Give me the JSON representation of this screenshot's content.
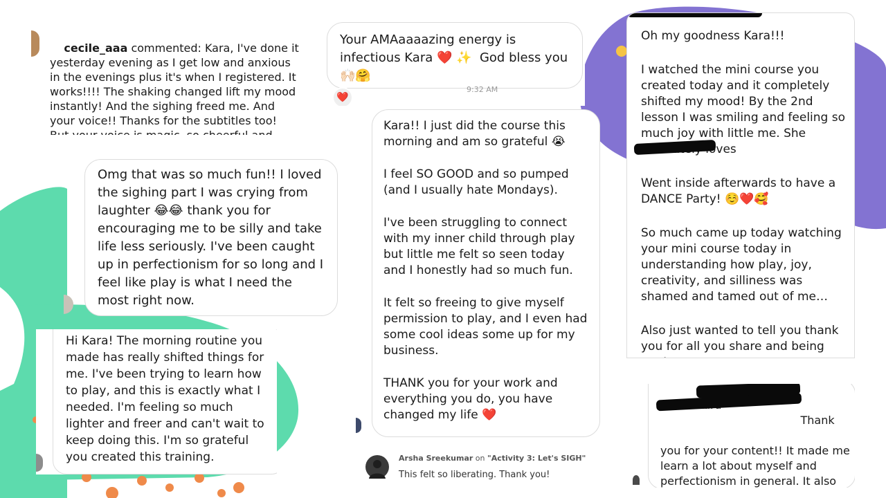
{
  "testimonial_1": {
    "username": "cecile_aaa",
    "text": "commented: Kara, I've done it yesterday evening as I get low and anxious in the evenings plus it's when I registered. It works!!!! The shaking changed lift my mood instantly! And the sighing freed me. And your voice!! Thanks for the subtitles too! But your voice is magic, so cheerful and kind! So"
  },
  "testimonial_2": {
    "text": "Your AMAaaaazing energy is infectious Kara ❤️ ✨  God bless you 🙌🏻🤗",
    "time": "9:32 AM",
    "reaction": "❤️"
  },
  "testimonial_3": {
    "paragraphs": [
      "Oh my goodness Kara!!!",
      "I watched the mini course you created today and it completely shifted my mood! By the 2nd lesson I was smiling and feeling so much joy with little me. She absolutely loves",
      "Went inside afterwards to have a DANCE Party! ☺️❤️🥰",
      "So much came up today watching your mini course today in understanding how play, joy, creativity, and silliness was shamed and tamed out of me…",
      "Also just wanted to tell you thank you for all you share and being you!"
    ]
  },
  "testimonial_4": {
    "text": "Omg that was so much fun!! I loved the sighing part I was crying from laughter 😂😂 thank you for encouraging me to be silly and take life less seriously. I've been caught up in perfectionism for so long and I feel like play is what I need the most right now."
  },
  "testimonial_5": {
    "paragraphs": [
      "Kara!! I just did the course this morning and am so grateful 😭",
      "I feel SO GOOD and so pumped (and I usually hate Mondays).",
      "I've been struggling to connect with my inner child through play but little me felt so seen today and I honestly had so much fun.",
      "It felt so freeing to give myself permission to play, and I even had some cool ideas some up for my business.",
      "THANK you for your work and everything you do, you have changed my life ❤️"
    ]
  },
  "testimonial_6": {
    "text": "Hi Kara! The morning routine you made has really shifted things for me. I've been trying to learn how to play, and this is exactly what I needed. I'm feeling so much lighter and freer and can't wait to keep doing this. I'm so grateful you created this training."
  },
  "testimonial_7": {
    "author": "Arsha Sreekumar",
    "on_word": "on",
    "activity": "\"Activity 3: Let's SIGH\"",
    "text": "This felt so liberating. Thank you!"
  },
  "testimonial_8": {
    "greeting": "Hi Kara",
    "thank": "Thank",
    "text": "you for your content!! It made me learn a lot about myself and perfectionism in general. It also helped me a lot in my process to be more loving to myself ❤️"
  },
  "colors": {
    "purple_blob": "#8373d2",
    "green_blob": "#5ddbad",
    "orange_dots": "#ef8a4a"
  },
  "icons": [
    "heart-reaction-icon",
    "user-avatar-icon"
  ]
}
